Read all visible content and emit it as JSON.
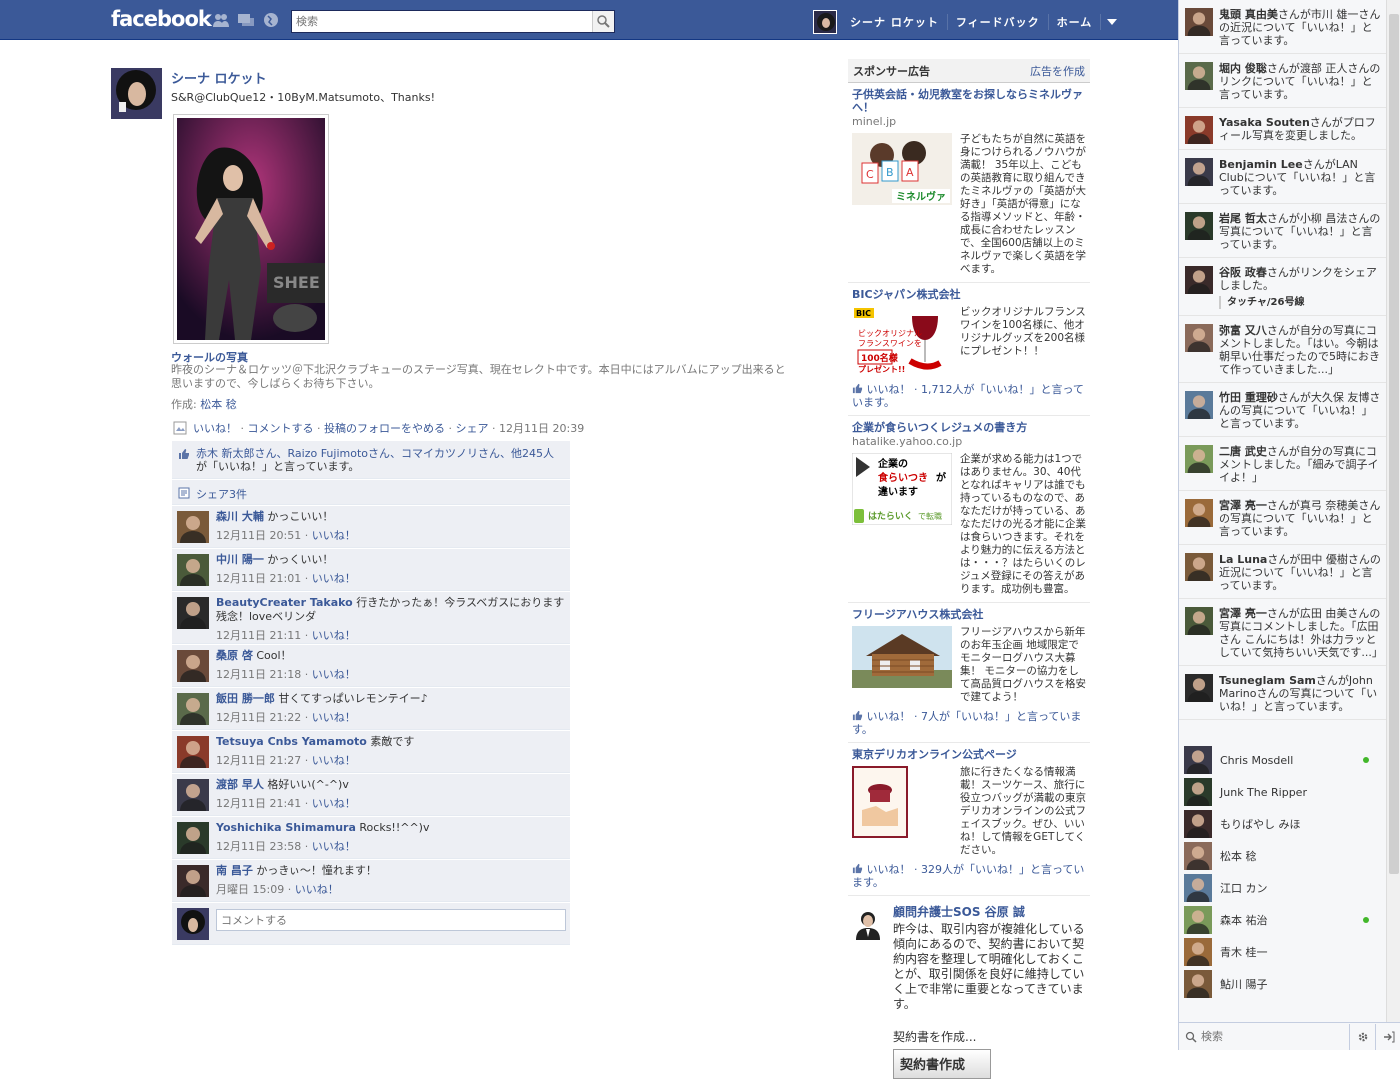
{
  "topbar": {
    "logo": "facebook",
    "search_placeholder": "検索",
    "user_name": "シーナ ロケット",
    "feedback": "フィードバック",
    "home": "ホーム"
  },
  "post": {
    "author": "シーナ ロケット",
    "text": "S&R@ClubQue12・10ByM.Matsumoto、Thanks!",
    "album_title": "ウォールの写真",
    "album_desc": "昨夜のシーナ＆ロケッツ＠下北沢クラブキューのステージ写真、現在セレクト中です。本日中にはアルバムにアップ出来ると思いますので、今しばらくお待ち下さい。",
    "credit_prefix": "作成: ",
    "credit_name": "松本 稔",
    "actions": {
      "like": "いいね！",
      "comment": "コメントする",
      "unfollow": "投稿のフォローをやめる",
      "share": "シェア",
      "time": "12月11日 20:39"
    },
    "likes_text_names": "赤木 新太郎さん、Raizo Fujimotoさん、コマイカツノリさん、他245人",
    "likes_text_suffix": "が「いいね！」と言っています。",
    "shares": "シェア3件",
    "comment_placeholder": "コメントする",
    "comments": [
      {
        "name": "森川 大輔",
        "text": "かっこいい！",
        "time": "12月11日 20:51",
        "like": "いいね！"
      },
      {
        "name": "中川 陽一",
        "text": "かっくいい！",
        "time": "12月11日 21:01",
        "like": "いいね！"
      },
      {
        "name": "BeautyCreater Takako",
        "text": "行きたかったぁ！今ラスベガスにおります残念！loveベリンダ",
        "time": "12月11日 21:11",
        "like": "いいね！"
      },
      {
        "name": "桑原 啓",
        "text": "Cool！",
        "time": "12月11日 21:18",
        "like": "いいね！"
      },
      {
        "name": "飯田 勝一郎",
        "text": "甘くてすっぱいレモンテイー♪",
        "time": "12月11日 21:22",
        "like": "いいね！"
      },
      {
        "name": "Tetsuya Cnbs Yamamoto",
        "text": "素敵です",
        "time": "12月11日 21:27",
        "like": "いいね！"
      },
      {
        "name": "渡部 早人",
        "text": "格好いい(^-^)v",
        "time": "12月11日 21:41",
        "like": "いいね！"
      },
      {
        "name": "Yoshichika Shimamura",
        "text": "Rocks!!^^)v",
        "time": "12月11日 23:58",
        "like": "いいね！"
      },
      {
        "name": "南 昌子",
        "text": "かっきぃ〜！憧れます！",
        "time": "月曜日 15:09",
        "like": "いいね！"
      }
    ]
  },
  "ads": {
    "header": "スポンサー広告",
    "create": "広告を作成",
    "items": [
      {
        "title": "子供英会話・幼児教室をお探しならミネルヴァへ！",
        "url": "minel.jp",
        "text": "子どもたちが自然に英語を身につけられるノウハウが満載！ 35年以上、こどもの英語教育に取り組んできたミネルヴァの「英語が大好き」「英語が得意」になる指導メソッドと、年齢・成長に合わせたレッスンで、全国600店舗以上のミネルヴァで楽しく英語を学べます。",
        "like": ""
      },
      {
        "title": "BICジャパン株式会社",
        "url": "",
        "text": "ビックオリジナルフランスワインを100名様に、他オリジナルグッズを200名様にプレゼント！！",
        "like": "いいね！ · 1,712人が「いいね！」と言っています。"
      },
      {
        "title": "企業が食らいつくレジュメの書き方",
        "url": "hatalike.yahoo.co.jp",
        "text": "企業が求める能力は1つではありません。30、40代となればキャリアは誰でも持っているものなので、あなただけが持っている、あなただけの光る才能に企業は食らいつきます。それをより魅力的に伝える方法とは・・・？はたらいくのレジュメ登録にその答えがあります。成功例も豊富。",
        "like": ""
      },
      {
        "title": "フリージアハウス株式会社",
        "url": "",
        "text": "フリージアハウスから新年のお年玉企画 地域限定でモニターログハウス大募集！ モニターの協力をして高品質ログハウスを格安で建てよう！",
        "like": "いいね！ · 7人が「いいね！」と言っています。"
      },
      {
        "title": "東京デリカオンライン公式ページ",
        "url": "",
        "text": "旅に行きたくなる情報満載！スーツケース、旅行に役立つバッグが満載の東京デリカオンラインの公式フェイスブック。ぜひ、いいね！して情報をGETしてください。",
        "like": "いいね！ · 329人が「いいね！」と言っています。"
      }
    ],
    "lawyer": {
      "title": "顧問弁護士SOS 谷原 誠",
      "text": "昨今は、取引内容が複雑化している傾向にあるので、契約書において契約内容を整理して明確化しておくことが、取引関係を良好に維持していく上で非常に重要となってきています。",
      "link": "契約書を作成...",
      "banner": "契約書作成"
    }
  },
  "ticker": [
    {
      "name": "鬼頭 真由美",
      "text": "さんが市川 雄一さんの近況について「いいね！」と言っています。"
    },
    {
      "name": "堀内 俊聡",
      "text": "さんが渡部 正人さんのリンクについて「いいね！」と言っています。"
    },
    {
      "name": "Yasaka Souten",
      "text": "さんがプロフィール写真を変更しました。"
    },
    {
      "name": "Benjamin Lee",
      "text": "さんがLAN Clubについて「いいね！」と言っています。"
    },
    {
      "name": "岩尾 哲太",
      "text": "さんが小柳 昌法さんの写真について「いいね！」と言っています。"
    },
    {
      "name": "谷阪 政春",
      "text": "さんがリンクをシェアしました。",
      "quote": "タッチャ/26号線"
    },
    {
      "name": "弥富 又八",
      "text": "さんが自分の写真にコメントしました。「はい。今朝は朝早い仕事だったので5時におきて作っていきました...」"
    },
    {
      "name": "竹田 重理砂",
      "text": "さんが大久保 友博さんの写真について「いいね！」と言っています。"
    },
    {
      "name": "二唐 武史",
      "text": "さんが自分の写真にコメントしました。「細みで調子イイよ！」"
    },
    {
      "name": "宮澤 亮一",
      "text": "さんが真弓 奈穂美さんの写真について「いいね！」と言っています。"
    },
    {
      "name": "La Luna",
      "text": "さんが田中 優樹さんの近況について「いいね！」と言っています。"
    },
    {
      "name": "宮澤 亮一",
      "text": "さんが広田 由美さんの写真にコメントしました。「広田さん こんにちは！外は力ラッとしていて気持ちいい天気です...」"
    },
    {
      "name": "Tsuneglam Sam",
      "text": "さんがJohn Marinoさんの写真について「いいね！」と言っています。"
    }
  ],
  "chat": [
    {
      "name": "Chris Mosdell",
      "online": true
    },
    {
      "name": "Junk The Ripper",
      "online": false
    },
    {
      "name": "もりばやし みほ",
      "online": false
    },
    {
      "name": "松本 稔",
      "online": false
    },
    {
      "name": "江口 カン",
      "online": false
    },
    {
      "name": "森本 祐治",
      "online": true
    },
    {
      "name": "青木 桂一",
      "online": false
    },
    {
      "name": "鮎川 陽子",
      "online": false
    }
  ],
  "chat_search_placeholder": "検索"
}
